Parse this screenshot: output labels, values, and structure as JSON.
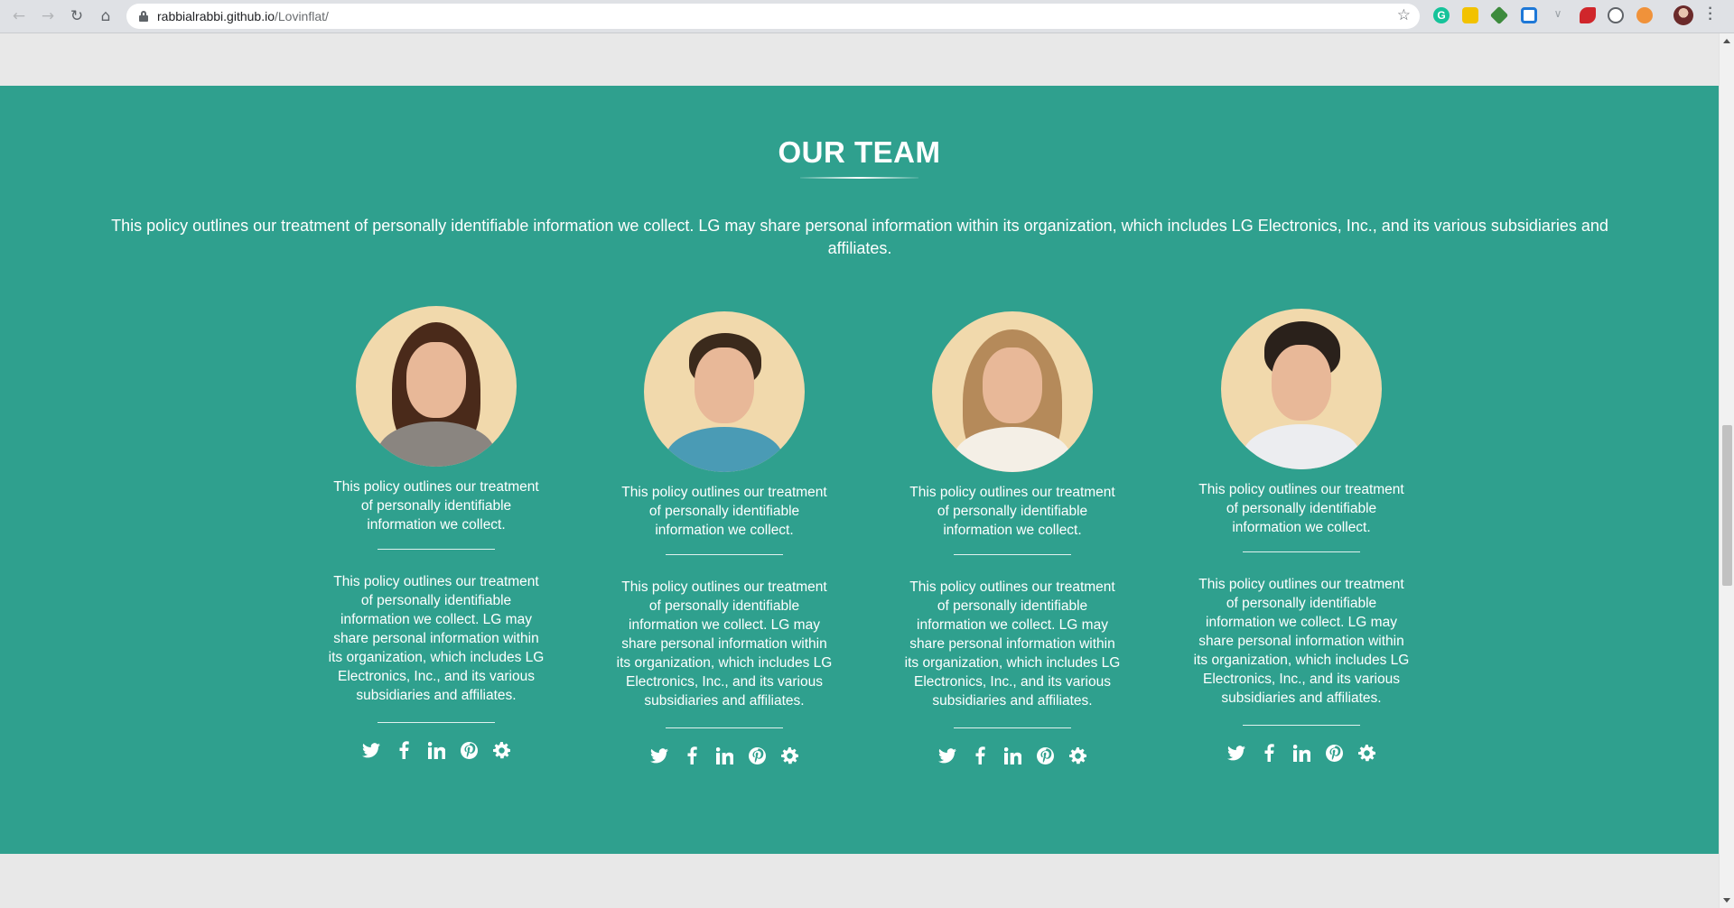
{
  "browser": {
    "url_host": "rabbialrabbi.github.io",
    "url_path": "/Lovinflat/",
    "extensions": [
      "grammarly-icon",
      "notes-extension-icon",
      "green-extension-icon",
      "blue-square-extension-icon",
      "v-extension-icon",
      "red-extension-icon",
      "circle-extension-icon",
      "orange-extension-icon"
    ]
  },
  "team": {
    "title": "OUR TEAM",
    "intro": "This policy outlines our treatment of personally identifiable information we collect.   LG may share personal information within its organization, which includes LG Electronics, Inc., and its various subsidiaries and affiliates.",
    "background_color": "#2fa08e",
    "members": [
      {
        "bio_short": "This policy outlines our treatment of personally identifiable information we collect.",
        "bio_long": "This policy outlines our treatment of personally identifiable information we collect.   LG may share personal information within its organization, which includes LG Electronics, Inc., and its various subsidiaries and affiliates.",
        "socials": [
          "twitter-icon",
          "facebook-icon",
          "linkedin-icon",
          "pinterest-icon",
          "gear-icon"
        ]
      },
      {
        "bio_short": "This policy outlines our treatment of personally identifiable information we collect.",
        "bio_long": "This policy outlines our treatment of personally identifiable information we collect.   LG may share personal information within its organization, which includes LG Electronics, Inc., and its various subsidiaries and affiliates.",
        "socials": [
          "twitter-icon",
          "facebook-icon",
          "linkedin-icon",
          "pinterest-icon",
          "gear-icon"
        ]
      },
      {
        "bio_short": "This policy outlines our treatment of personally identifiable information we collect.",
        "bio_long": "This policy outlines our treatment of personally identifiable information we collect.   LG may share personal information within its organization, which includes LG Electronics, Inc., and its various subsidiaries and affiliates.",
        "socials": [
          "twitter-icon",
          "facebook-icon",
          "linkedin-icon",
          "pinterest-icon",
          "gear-icon"
        ]
      },
      {
        "bio_short": "This policy outlines our treatment of personally identifiable information we collect.",
        "bio_long": "This policy outlines our treatment of personally identifiable information we collect.   LG may share personal information within its organization, which includes LG Electronics, Inc., and its various subsidiaries and affiliates.",
        "socials": [
          "twitter-icon",
          "facebook-icon",
          "linkedin-icon",
          "pinterest-icon",
          "gear-icon"
        ]
      }
    ]
  }
}
